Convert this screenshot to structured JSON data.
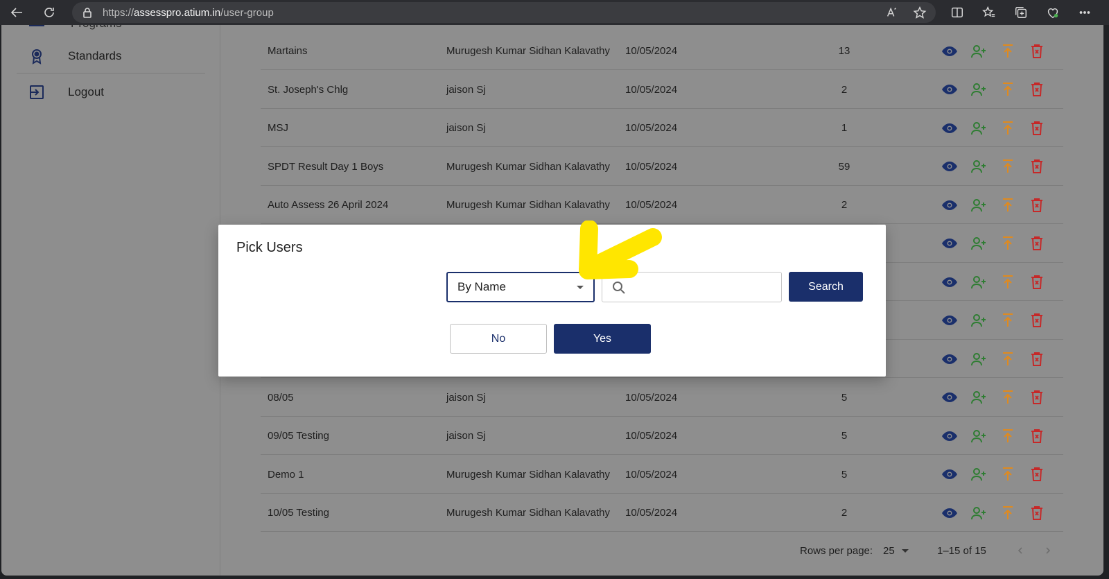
{
  "browser": {
    "url_prefix": "https://",
    "url_domain": "assesspro.atium.in",
    "url_path": "/user-group"
  },
  "sidebar": {
    "partial_label": "Programs",
    "items": [
      {
        "label": "Standards",
        "icon": "award-icon"
      },
      {
        "label": "Logout",
        "icon": "logout-icon"
      }
    ]
  },
  "table": {
    "rows": [
      {
        "name": "Martains",
        "owner": "Murugesh Kumar Sidhan Kalavathy",
        "date": "10/05/2024",
        "count": "13"
      },
      {
        "name": "St. Joseph's Chlg",
        "owner": "jaison Sj",
        "date": "10/05/2024",
        "count": "2"
      },
      {
        "name": "MSJ",
        "owner": "jaison Sj",
        "date": "10/05/2024",
        "count": "1"
      },
      {
        "name": "SPDT Result Day 1 Boys",
        "owner": "Murugesh Kumar Sidhan Kalavathy",
        "date": "10/05/2024",
        "count": "59"
      },
      {
        "name": "Auto Assess 26 April 2024",
        "owner": "Murugesh Kumar Sidhan Kalavathy",
        "date": "10/05/2024",
        "count": "2"
      },
      {
        "name": "",
        "owner": "",
        "date": "",
        "count": ""
      },
      {
        "name": "",
        "owner": "",
        "date": "",
        "count": ""
      },
      {
        "name": "",
        "owner": "",
        "date": "",
        "count": ""
      },
      {
        "name": "",
        "owner": "",
        "date": "",
        "count": ""
      },
      {
        "name": "08/05",
        "owner": "jaison Sj",
        "date": "10/05/2024",
        "count": "5"
      },
      {
        "name": "09/05 Testing",
        "owner": "jaison Sj",
        "date": "10/05/2024",
        "count": "5"
      },
      {
        "name": "Demo 1",
        "owner": "Murugesh Kumar Sidhan Kalavathy",
        "date": "10/05/2024",
        "count": "5"
      },
      {
        "name": "10/05 Testing",
        "owner": "Murugesh Kumar Sidhan Kalavathy",
        "date": "10/05/2024",
        "count": "2"
      }
    ],
    "action_colors": {
      "view": "#1a2f6b",
      "add_user": "#2e7d32",
      "upload": "#e08a1e",
      "delete": "#c62828"
    }
  },
  "pager": {
    "rows_label": "Rows per page:",
    "rows_value": "25",
    "range": "1–15 of 15"
  },
  "modal": {
    "title": "Pick Users",
    "filter_value": "By Name",
    "search_value": "",
    "search_button": "Search",
    "no_button": "No",
    "yes_button": "Yes"
  },
  "colors": {
    "primary": "#1a2f6b",
    "highlight": "#ffe600"
  }
}
